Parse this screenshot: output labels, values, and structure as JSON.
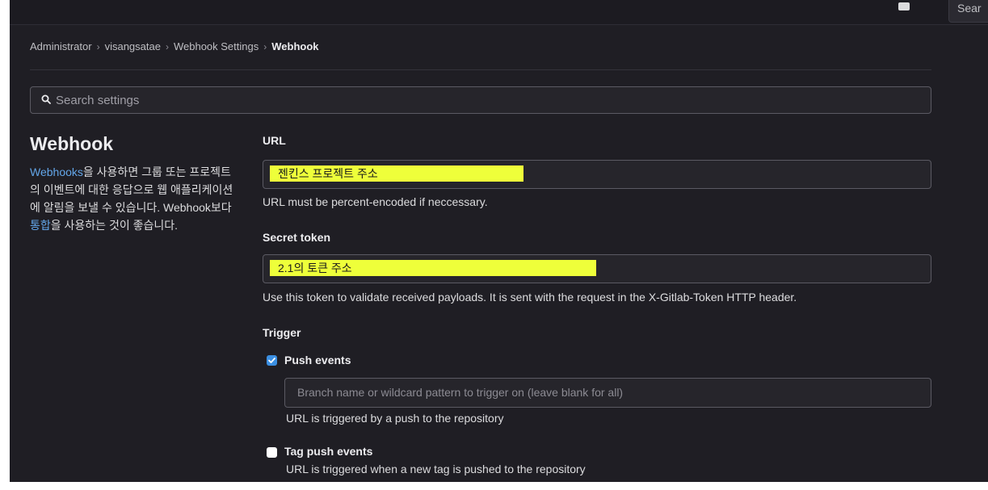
{
  "topbar": {
    "button_label": "Sear"
  },
  "breadcrumb": [
    "Administrator",
    "visangsatae",
    "Webhook Settings",
    "Webhook"
  ],
  "search": {
    "placeholder": "Search settings"
  },
  "sidebar": {
    "title": "Webhook",
    "link_webhooks": "Webhooks",
    "text1": "을 사용하면 그룹 또는 프로젝트의 이벤트에 대한 응답으로 웹 애플리케이션에 알림을 보낼 수 있습니다. Webhook보다 ",
    "link_integrations": "통합",
    "text2": "을 사용하는 것이 좋습니다."
  },
  "form": {
    "url": {
      "label": "URL",
      "value": "젠킨스 프로젝트 주소",
      "help": "URL must be percent-encoded if neccessary."
    },
    "secret_token": {
      "label": "Secret token",
      "value": "2.1의 토큰 주소",
      "help": "Use this token to validate received payloads. It is sent with the request in the X-Gitlab-Token HTTP header."
    },
    "trigger": {
      "label": "Trigger",
      "push_events": {
        "label": "Push events",
        "checked": true,
        "branch_placeholder": "Branch name or wildcard pattern to trigger on (leave blank for all)",
        "help": "URL is triggered by a push to the repository"
      },
      "tag_push_events": {
        "label": "Tag push events",
        "checked": false,
        "help": "URL is triggered when a new tag is pushed to the repository"
      }
    }
  },
  "colors": {
    "background": "#1f1e24",
    "highlight": "#eeff3a",
    "link": "#63a6e9",
    "checkbox": "#3b8fe2"
  }
}
